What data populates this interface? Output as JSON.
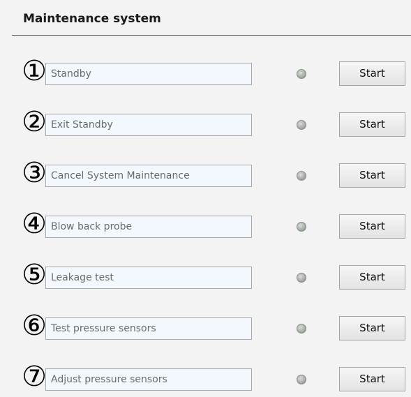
{
  "header": {
    "title": "Maintenance system"
  },
  "steps": [
    {
      "number": "①",
      "label": "Standby",
      "button": "Start",
      "indicator": "led-off-icon"
    },
    {
      "number": "②",
      "label": "Exit Standby",
      "button": "Start",
      "indicator": "led-off-icon"
    },
    {
      "number": "③",
      "label": "Cancel System Maintenance",
      "button": "Start",
      "indicator": "led-off-icon"
    },
    {
      "number": "④",
      "label": "Blow back probe",
      "button": "Start",
      "indicator": "led-off-icon"
    },
    {
      "number": "⑤",
      "label": "Leakage test",
      "button": "Start",
      "indicator": "led-off-icon"
    },
    {
      "number": "⑥",
      "label": "Test pressure sensors",
      "button": "Start",
      "indicator": "led-off-icon"
    },
    {
      "number": "⑦",
      "label": "Adjust pressure sensors",
      "button": "Start",
      "indicator": "led-off-icon"
    }
  ],
  "colors": {
    "background": "#f3f3f3",
    "field_background": "#f2f8fd",
    "field_text": "#6b6b6b",
    "led_off": "#a9b0a8"
  }
}
